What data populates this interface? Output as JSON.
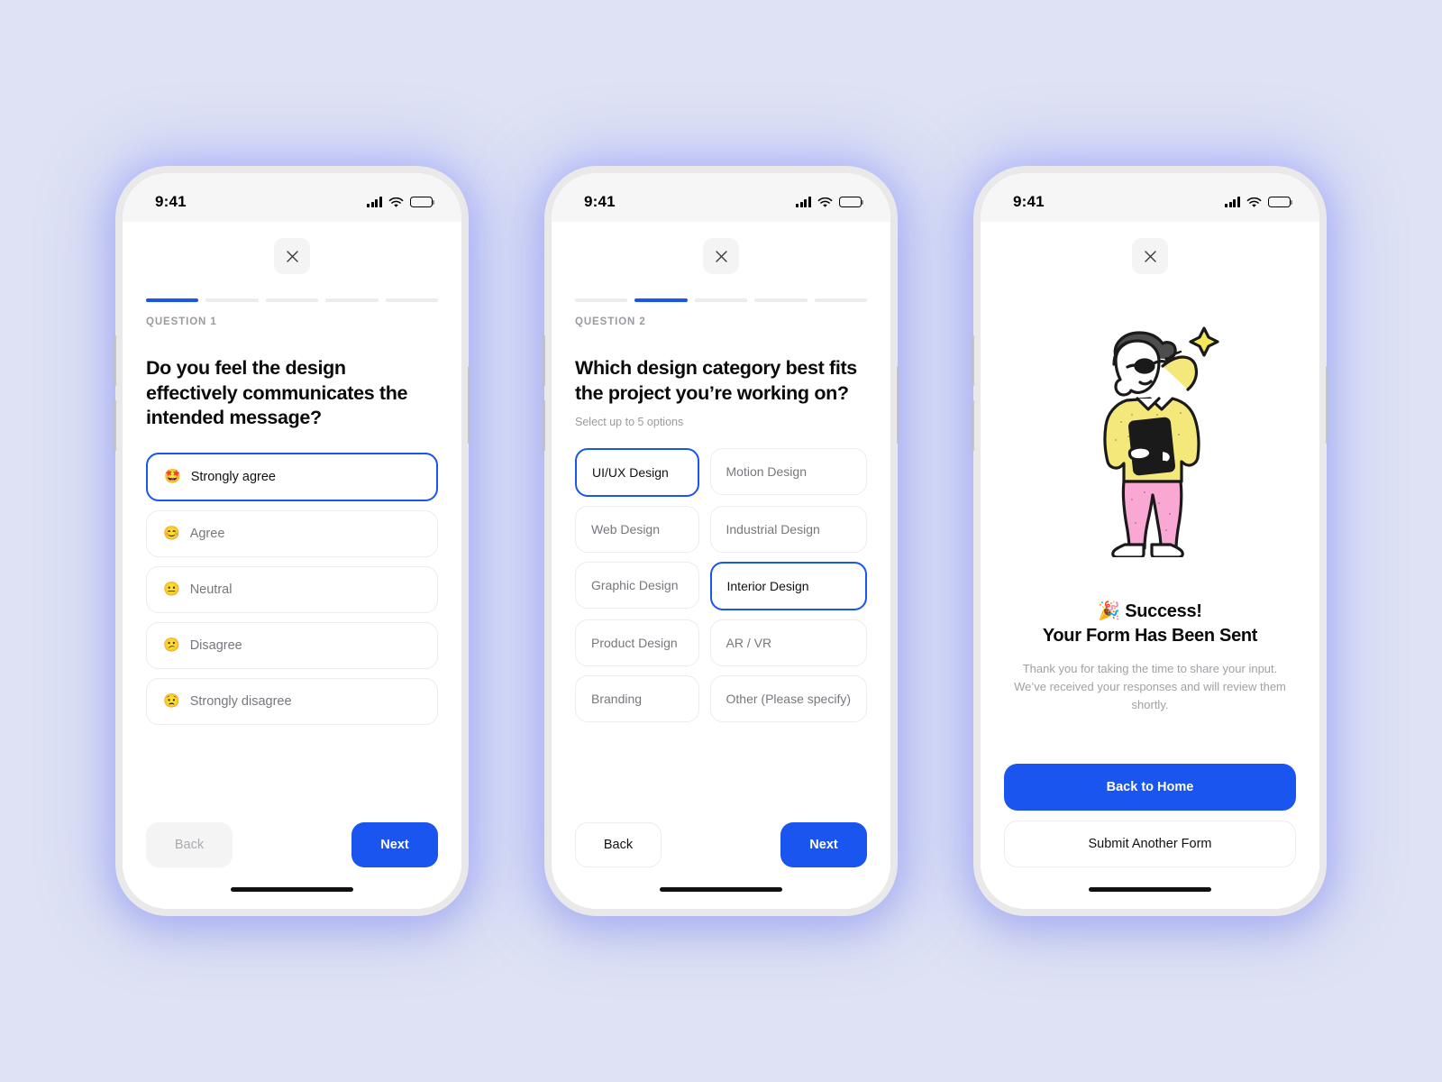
{
  "background_color": "#dee2f4",
  "accent_color": "#1a55f0",
  "statusbar": {
    "time": "9:41",
    "cellular_icon": "cellular-signal-icon",
    "wifi_icon": "wifi-icon",
    "battery_icon": "battery-full-icon"
  },
  "screens": [
    {
      "id": "question-1",
      "close_label": "×",
      "progress": {
        "total": 5,
        "current": 1
      },
      "question_label": "QUESTION 1",
      "title": "Do you feel the design effectively communicates the intended message?",
      "subtitle": "",
      "options": [
        {
          "emoji": "🤩",
          "label": "Strongly agree",
          "selected": true
        },
        {
          "emoji": "😊",
          "label": "Agree",
          "selected": false
        },
        {
          "emoji": "😐",
          "label": "Neutral",
          "selected": false
        },
        {
          "emoji": "😕",
          "label": "Disagree",
          "selected": false
        },
        {
          "emoji": "😟",
          "label": "Strongly disagree",
          "selected": false
        }
      ],
      "footer": {
        "back_label": "Back",
        "back_disabled": true,
        "next_label": "Next"
      }
    },
    {
      "id": "question-2",
      "close_label": "×",
      "progress": {
        "total": 5,
        "current": 2
      },
      "question_label": "QUESTION 2",
      "title": "Which design category best fits the project you’re working on?",
      "subtitle": "Select up to 5 options",
      "chips": [
        {
          "label": "UI/UX Design",
          "selected": true
        },
        {
          "label": "Motion Design",
          "selected": false
        },
        {
          "label": "Web Design",
          "selected": false
        },
        {
          "label": "Industrial Design",
          "selected": false
        },
        {
          "label": "Graphic Design",
          "selected": false
        },
        {
          "label": "Interior Design",
          "selected": true
        },
        {
          "label": "Product Design",
          "selected": false
        },
        {
          "label": "AR / VR",
          "selected": false
        },
        {
          "label": "Branding",
          "selected": false
        },
        {
          "label": "Other (Please specify)",
          "selected": false
        }
      ],
      "footer": {
        "back_label": "Back",
        "back_disabled": false,
        "next_label": "Next"
      }
    },
    {
      "id": "success",
      "close_label": "×",
      "illustration": "person-thinking-with-clipboard-illustration",
      "title_line1": "🎉 Success!",
      "title_line2": "Your Form Has Been Sent",
      "body": "Thank you for taking the time to share your input. We’ve received your responses and will review them shortly.",
      "actions": {
        "primary_label": "Back to Home",
        "secondary_label": "Submit Another Form"
      }
    }
  ]
}
